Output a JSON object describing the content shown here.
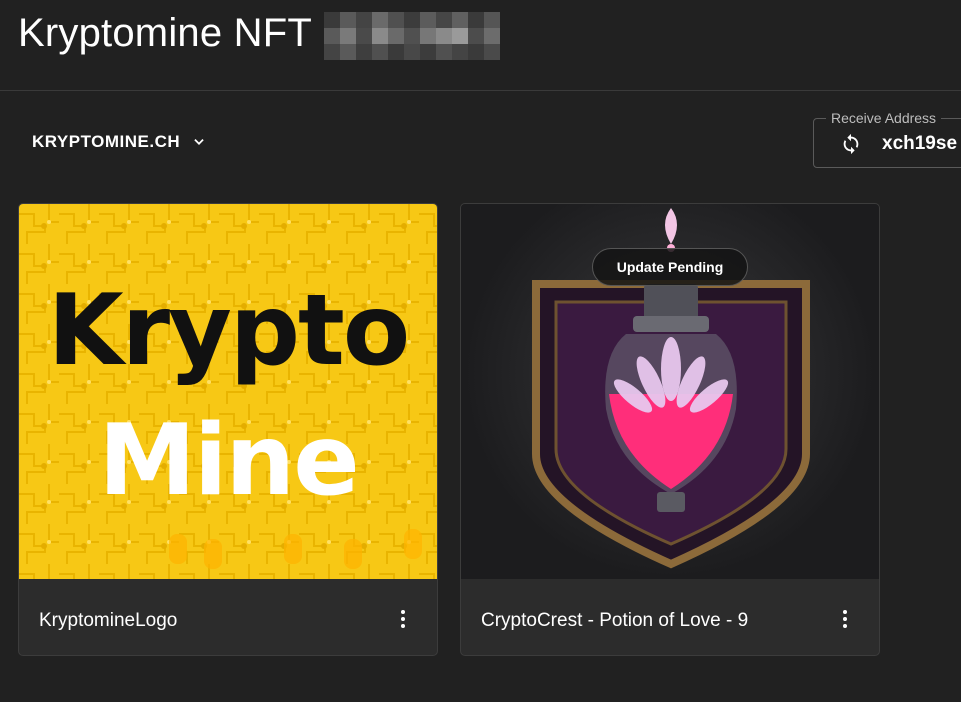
{
  "page": {
    "title": "Kryptomine NFT"
  },
  "wallet_selector": {
    "label": "KRYPTOMINE.CH"
  },
  "receive_address": {
    "legend": "Receive Address",
    "value": "xch19se"
  },
  "nfts": [
    {
      "name": "KryptomineLogo",
      "logo_line1": "Krypto",
      "logo_line2": "Mine",
      "background": "#f7c815"
    },
    {
      "name": "CryptoCrest - Potion of Love - 9",
      "badge": "Update Pending",
      "background": "#1c1c1e"
    }
  ],
  "colors": {
    "background": "#212121",
    "card": "#2c2c2c",
    "logo_yellow": "#f7c815",
    "potion_pink": "#ff2e7a"
  }
}
